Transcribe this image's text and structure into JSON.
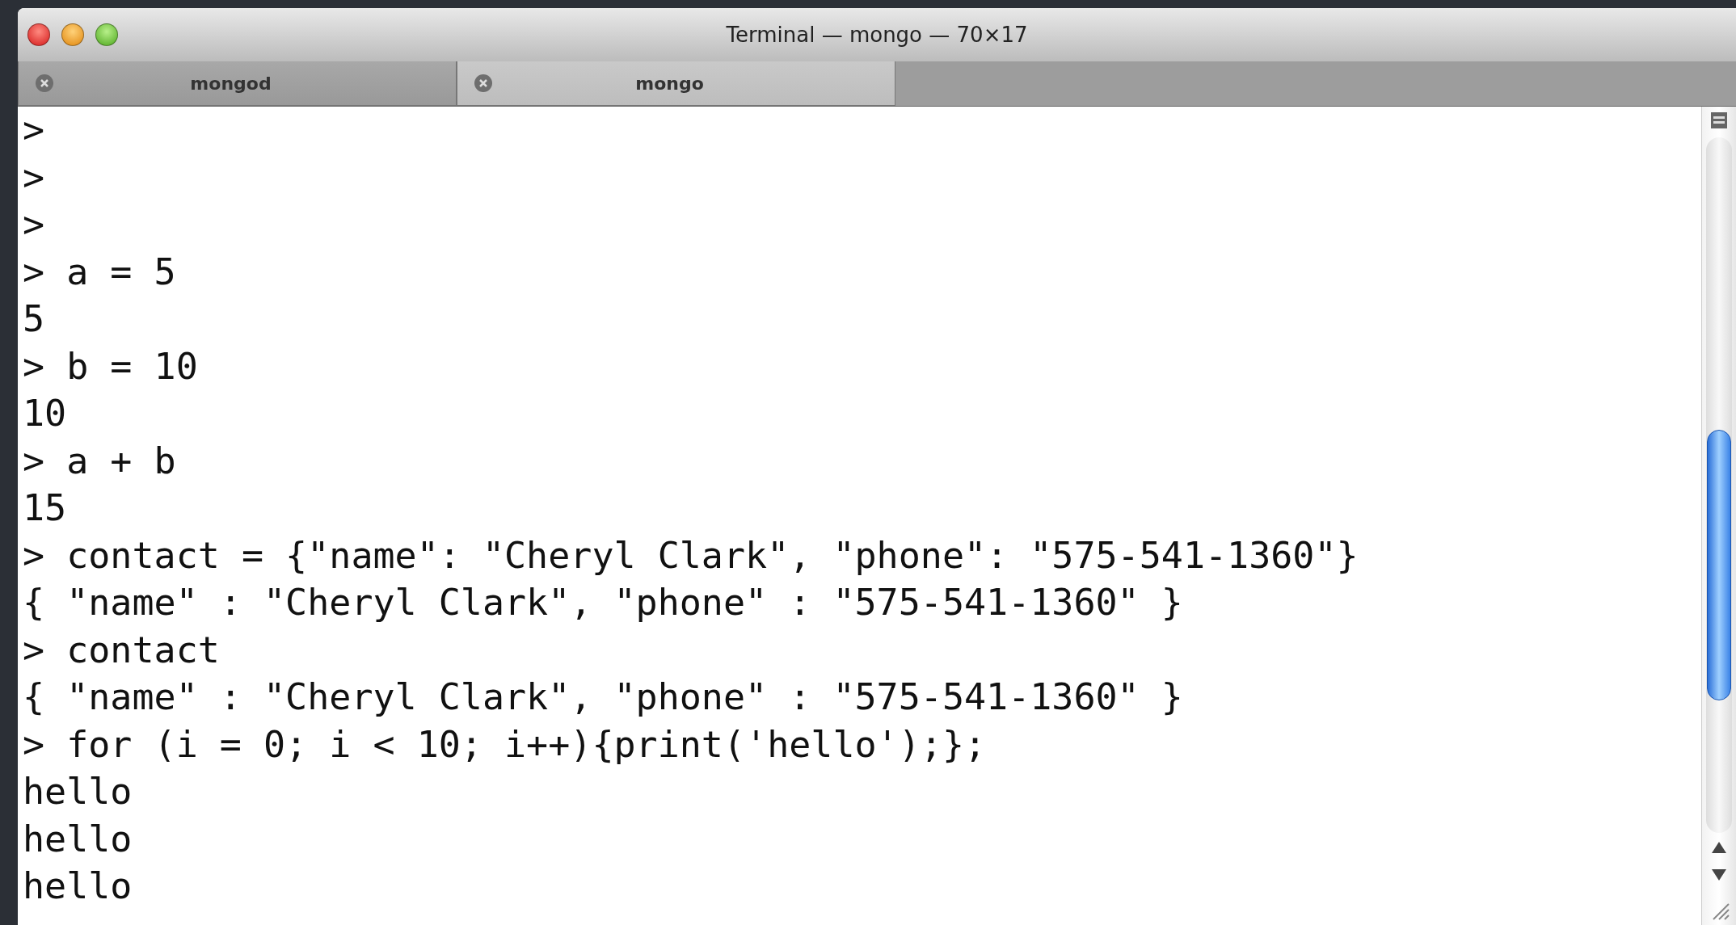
{
  "window": {
    "title": "Terminal — mongo — 70×17"
  },
  "tabs": [
    {
      "label": "mongod",
      "selected": false
    },
    {
      "label": "mongo",
      "selected": true
    }
  ],
  "lines": [
    ">",
    ">",
    ">",
    "> a = 5",
    "5",
    "> b = 10",
    "10",
    "> a + b",
    "15",
    "> contact = {\"name\": \"Cheryl Clark\", \"phone\": \"575-541-1360\"}",
    "{ \"name\" : \"Cheryl Clark\", \"phone\" : \"575-541-1360\" }",
    "> contact",
    "{ \"name\" : \"Cheryl Clark\", \"phone\" : \"575-541-1360\" }",
    "> for (i = 0; i < 10; i++){print('hello');};",
    "hello",
    "hello",
    "hello"
  ]
}
